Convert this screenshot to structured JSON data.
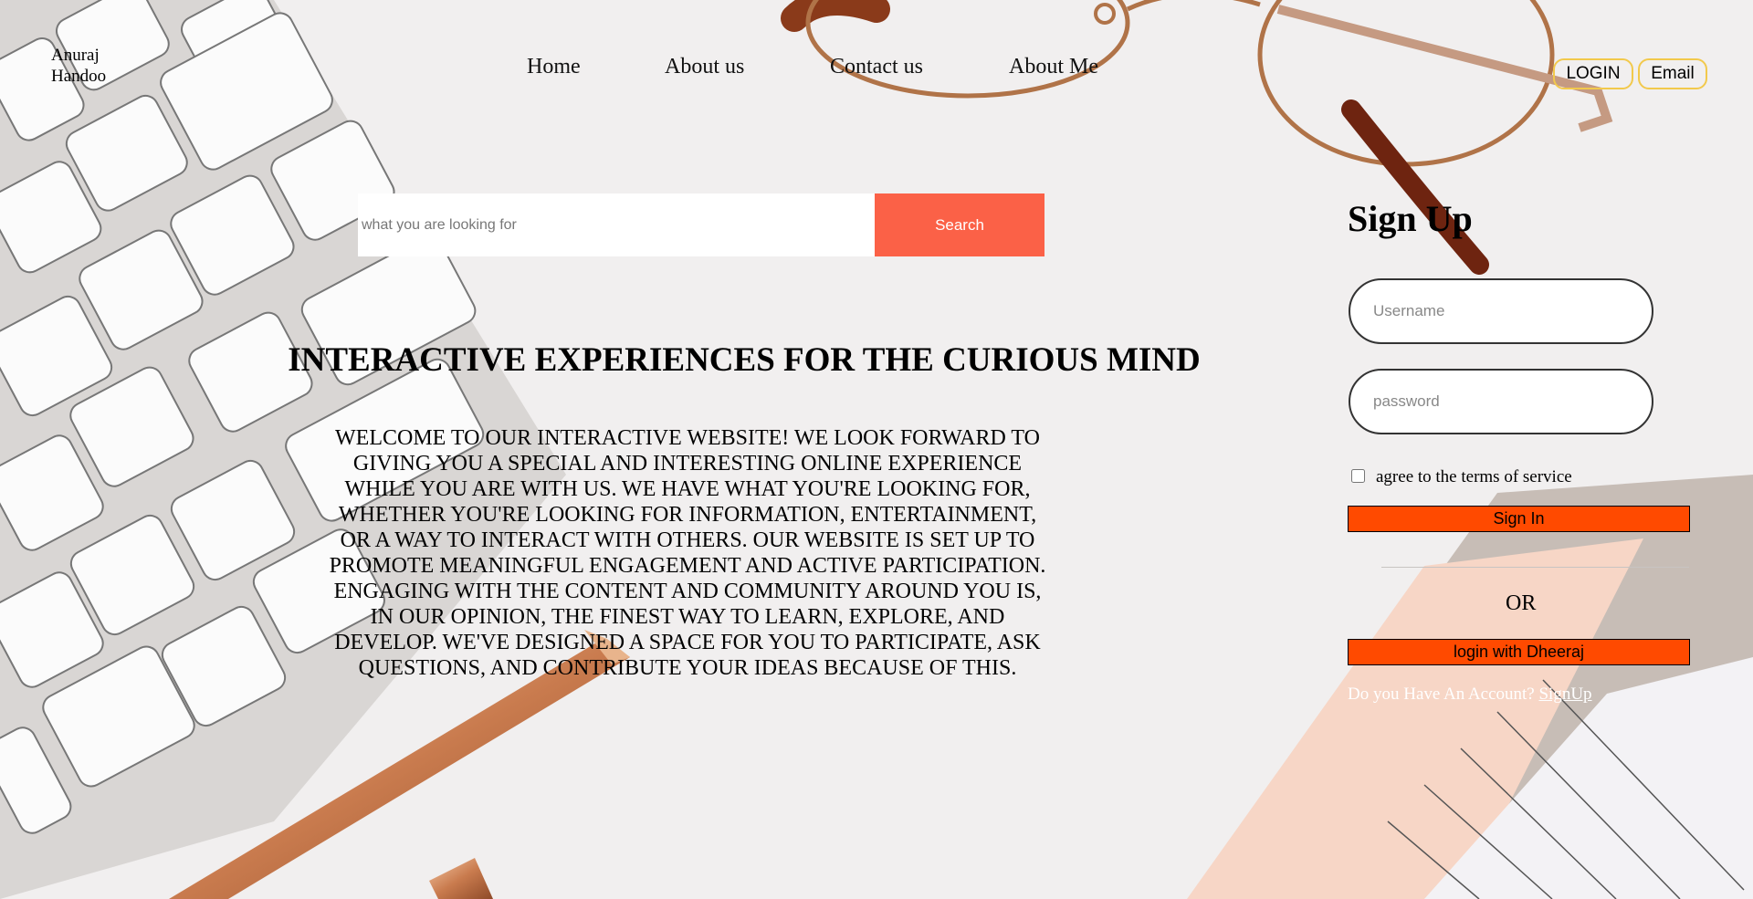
{
  "brand": {
    "line1": "Anuraj",
    "line2": "Handoo"
  },
  "nav": {
    "items": [
      {
        "label": "Home"
      },
      {
        "label": "About us"
      },
      {
        "label": "Contact us"
      },
      {
        "label": "About Me"
      }
    ]
  },
  "header_buttons": {
    "login": "LOGIN",
    "email": "Email",
    "border_color": "#f2c94c"
  },
  "search": {
    "placeholder": "what you are looking for",
    "button_label": "Search",
    "button_color": "#fb6147"
  },
  "hero": {
    "title": "INTERACTIVE EXPERIENCES FOR THE CURIOUS MIND",
    "body": "WELCOME TO OUR INTERACTIVE WEBSITE! WE LOOK FORWARD TO GIVING YOU A SPECIAL AND INTERESTING ONLINE EXPERIENCE WHILE YOU ARE WITH US. WE HAVE WHAT YOU'RE LOOKING FOR, WHETHER YOU'RE LOOKING FOR INFORMATION, ENTERTAINMENT, OR A WAY TO INTERACT WITH OTHERS. OUR WEBSITE IS SET UP TO PROMOTE MEANINGFUL ENGAGEMENT AND ACTIVE PARTICIPATION. ENGAGING WITH THE CONTENT AND COMMUNITY AROUND YOU IS, IN OUR OPINION, THE FINEST WAY TO LEARN, EXPLORE, AND DEVELOP. WE'VE DESIGNED A SPACE FOR YOU TO PARTICIPATE, ASK QUESTIONS, AND CONTRIBUTE YOUR IDEAS BECAUSE OF THIS."
  },
  "signup": {
    "title": "Sign Up",
    "username_placeholder": "Username",
    "password_placeholder": "password",
    "terms_label": "agree to the terms of service",
    "signin_label": "Sign In",
    "or_label": "OR",
    "alt_login_label": "login with Dheeraj",
    "account_prompt": "Do you Have An Account?",
    "signup_link": "SignUp",
    "accent_color": "#ff4a00"
  }
}
